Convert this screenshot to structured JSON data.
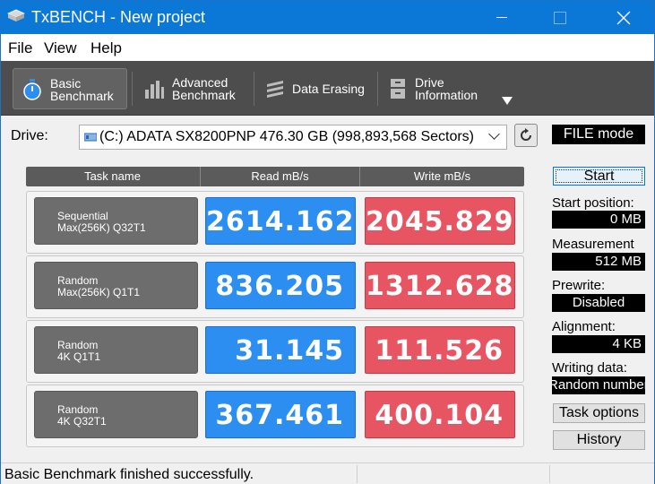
{
  "window": {
    "title": "TxBENCH - New project"
  },
  "menu": {
    "file": "File",
    "view": "View",
    "help": "Help"
  },
  "toolbar": {
    "basic": "Basic\nBenchmark",
    "advanced": "Advanced\nBenchmark",
    "erasing": "Data Erasing",
    "info": "Drive\nInformation"
  },
  "drive": {
    "label": "Drive:",
    "selected": "(C:) ADATA SX8200PNP  476.30 GB (998,893,568 Sectors)",
    "mode": "FILE mode"
  },
  "table": {
    "headers": {
      "task": "Task name",
      "read": "Read mB/s",
      "write": "Write mB/s"
    },
    "rows": [
      {
        "line1": "Sequential",
        "line2": "Max(256K) Q32T1",
        "read": "2614.162",
        "write": "2045.829"
      },
      {
        "line1": "Random",
        "line2": "Max(256K) Q1T1",
        "read": "836.205",
        "write": "1312.628"
      },
      {
        "line1": "Random",
        "line2": "4K Q1T1",
        "read": "31.145",
        "write": "111.526"
      },
      {
        "line1": "Random",
        "line2": "4K Q32T1",
        "read": "367.461",
        "write": "400.104"
      }
    ]
  },
  "panel": {
    "start": "Start",
    "start_position_label": "Start position:",
    "start_position": "0 MB",
    "measurement_label": "Measurement",
    "measurement": "512 MB",
    "prewrite_label": "Prewrite:",
    "prewrite": "Disabled",
    "alignment_label": "Alignment:",
    "alignment": "4 KB",
    "writing_data_label": "Writing data:",
    "writing_data": "Random number",
    "task_options": "Task options",
    "history": "History"
  },
  "status": {
    "message": "Basic Benchmark finished successfully."
  },
  "colors": {
    "read": "#2b8ef0",
    "write": "#e85562",
    "titlebar": "#0b78d8",
    "toolbar": "#4d4d4d"
  }
}
